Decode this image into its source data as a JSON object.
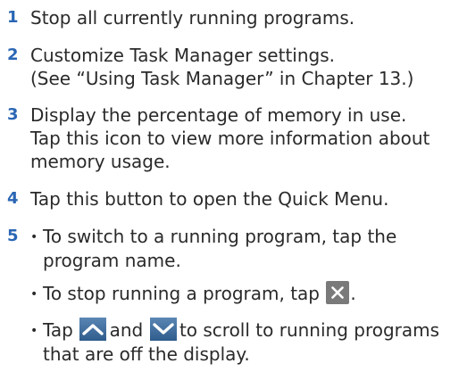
{
  "accent_color": "#2a66b4",
  "icon_bg_color": "#7a7a7a",
  "steps": [
    {
      "number": "1",
      "lines": [
        "Stop all currently running programs."
      ]
    },
    {
      "number": "2",
      "lines": [
        "Customize Task Manager settings.",
        "(See “Using Task Manager” in Chapter 13.)"
      ]
    },
    {
      "number": "3",
      "lines": [
        "Display the percentage of memory in use.",
        "Tap this icon to view more information about",
        "memory usage."
      ]
    },
    {
      "number": "4",
      "lines": [
        "Tap this button to open the Quick Menu."
      ]
    },
    {
      "number": "5",
      "bullets": [
        {
          "lines": [
            "To switch to a running program, tap the",
            "program name."
          ]
        },
        {
          "before": "To stop running a program, tap",
          "after": "."
        },
        {
          "before": "Tap",
          "middle": "and",
          "after": "to  scroll to running programs",
          "continuation": "that are off the display."
        }
      ]
    }
  ],
  "bullet_char": "•",
  "icons": [
    "close-icon",
    "scroll-up-icon",
    "scroll-down-icon"
  ]
}
